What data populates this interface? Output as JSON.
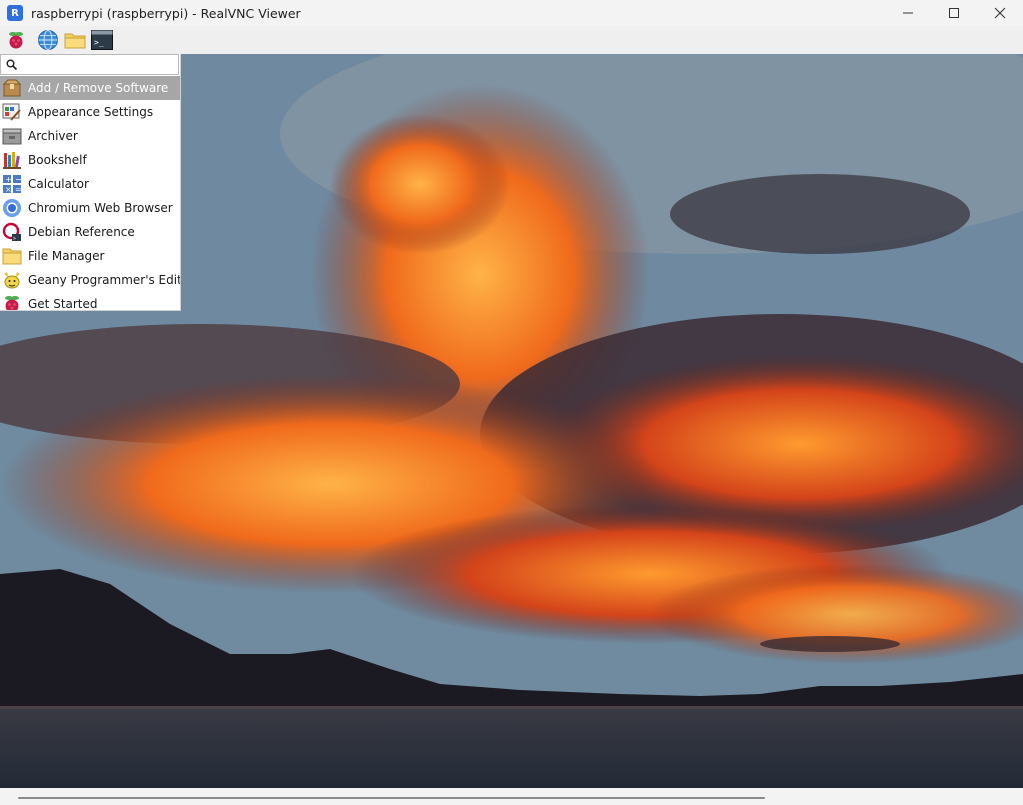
{
  "window": {
    "title": "raspberrypi (raspberrypi) - RealVNC Viewer",
    "app_icon_glyph": "R",
    "controls": {
      "minimize": "–",
      "maximize": "☐",
      "close": "✕"
    }
  },
  "taskbar": {
    "launchers": [
      {
        "icon": "raspberry-menu-icon"
      },
      {
        "icon": "web-browser-globe-icon"
      },
      {
        "icon": "file-manager-folder-icon"
      },
      {
        "icon": "terminal-icon",
        "glyph": ">_"
      }
    ]
  },
  "menu": {
    "search": {
      "value": "",
      "placeholder": ""
    },
    "items": [
      {
        "label": "Add / Remove Software",
        "icon": "package-box-icon",
        "selected": true
      },
      {
        "label": "Appearance Settings",
        "icon": "appearance-settings-icon"
      },
      {
        "label": "Archiver",
        "icon": "archiver-icon"
      },
      {
        "label": "Bookshelf",
        "icon": "bookshelf-icon"
      },
      {
        "label": "Calculator",
        "icon": "calculator-icon"
      },
      {
        "label": "Chromium Web Browser",
        "icon": "chromium-icon"
      },
      {
        "label": "Debian Reference",
        "icon": "debian-reference-icon"
      },
      {
        "label": "File Manager",
        "icon": "folder-icon"
      },
      {
        "label": "Geany Programmer's Editor",
        "icon": "geany-icon"
      },
      {
        "label": "Get Started",
        "icon": "raspberry-icon"
      }
    ]
  },
  "colors": {
    "selected_bg": "#a6a6a6",
    "menu_bg": "#ffffff",
    "titlebar_bg": "#f3f3f3"
  }
}
